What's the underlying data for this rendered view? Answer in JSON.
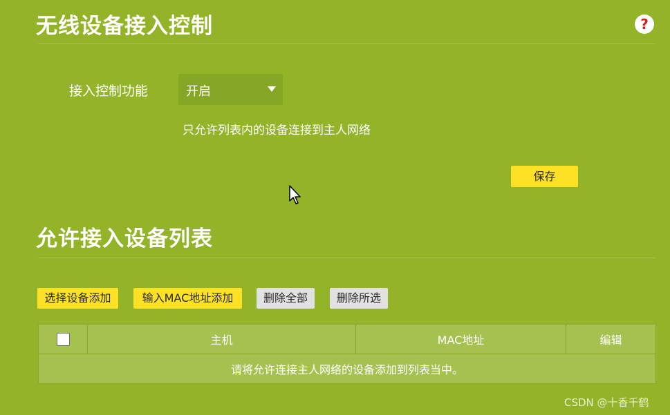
{
  "access_control": {
    "title": "无线设备接入控制",
    "help_icon": "?",
    "function_label": "接入控制功能",
    "function_value": "开启",
    "hint": "只允许列表内的设备连接到主人网络",
    "save_label": "保存"
  },
  "allowed_list": {
    "title": "允许接入设备列表",
    "buttons": {
      "select_add": "选择设备添加",
      "input_mac_add": "输入MAC地址添加",
      "delete_all": "删除全部",
      "delete_selected": "删除所选"
    },
    "table": {
      "columns": [
        "主机",
        "MAC地址",
        "编辑"
      ],
      "empty_message": "请将允许连接主人网络的设备添加到列表当中。"
    }
  },
  "watermark": "CSDN @十香千鹤",
  "colors": {
    "background": "#93b428",
    "button_yellow": "#fde124",
    "button_gray": "#e2e2e2",
    "help_red": "#d3221d"
  },
  "icons": {
    "help": "question-mark-icon",
    "dropdown": "triangle-down-icon",
    "cursor": "mouse-pointer-icon"
  }
}
